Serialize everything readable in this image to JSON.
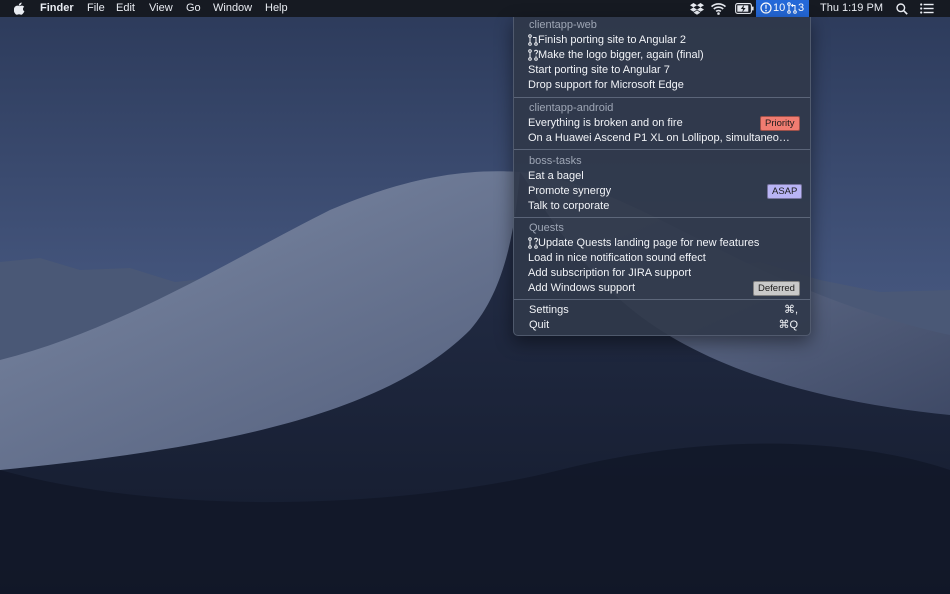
{
  "menubar": {
    "apple_icon": "apple-icon",
    "app_name": "Finder",
    "menus": [
      "File",
      "Edit",
      "View",
      "Go",
      "Window",
      "Help"
    ],
    "status_icons": [
      "dropbox-icon",
      "wifi-icon",
      "battery-charging-icon"
    ],
    "status_item": {
      "issues_icon": "issue-icon",
      "issues_count": "10",
      "prs_icon": "pull-request-icon",
      "prs_count": "3"
    },
    "clock": "Thu 1:19 PM",
    "right_icons": [
      "spotlight-search-icon",
      "notification-center-icon"
    ]
  },
  "dropdown": {
    "sections": [
      {
        "name": "clientapp-web",
        "items": [
          {
            "label": "Finish porting site to Angular 2",
            "icon": "pull-request-icon"
          },
          {
            "label": "Make the logo bigger, again (final)",
            "icon": "draft-pull-request-icon"
          },
          {
            "label": "Start porting site to Angular 7"
          },
          {
            "label": "Drop support for Microsoft Edge"
          }
        ]
      },
      {
        "name": "clientapp-android",
        "items": [
          {
            "label": "Everything is broken and on fire",
            "badge": "Priority"
          },
          {
            "label": "On a Huawei Ascend P1 XL on Lollipop, simultaneous…"
          }
        ]
      },
      {
        "name": "boss-tasks",
        "items": [
          {
            "label": "Eat a bagel"
          },
          {
            "label": "Promote synergy",
            "badge": "ASAP"
          },
          {
            "label": "Talk to corporate"
          }
        ]
      },
      {
        "name": "Quests",
        "items": [
          {
            "label": "Update Quests landing page for new features",
            "icon": "draft-pull-request-icon"
          },
          {
            "label": "Load in nice notification sound effect"
          },
          {
            "label": "Add subscription for JIRA support"
          },
          {
            "label": "Add Windows support",
            "badge": "Deferred"
          }
        ]
      }
    ],
    "footer": [
      {
        "label": "Settings",
        "shortcut": "⌘,"
      },
      {
        "label": "Quit",
        "shortcut": "⌘Q"
      }
    ]
  },
  "colors": {
    "menubar_bg": "#16191f",
    "status_highlight": "#2468d8",
    "badge_priority": "#f07c71",
    "badge_asap": "#b9b4f5",
    "badge_deferred": "#c9c9c9"
  }
}
